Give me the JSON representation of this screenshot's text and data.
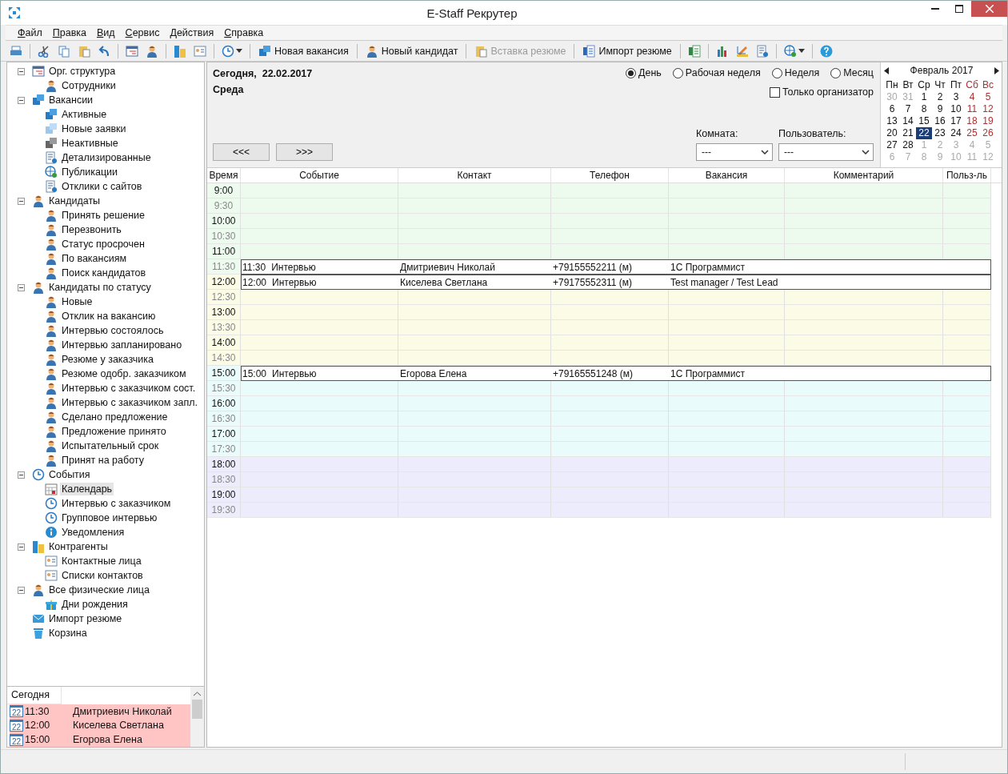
{
  "window": {
    "title": "E-Staff Рекрутер"
  },
  "menu": [
    "Файл",
    "Правка",
    "Вид",
    "Сервис",
    "Действия",
    "Справка"
  ],
  "toolbar": [
    {
      "kind": "icon"
    },
    {
      "kind": "sep"
    },
    {
      "kind": "icon"
    },
    {
      "kind": "icon"
    },
    {
      "kind": "icon"
    },
    {
      "kind": "icon"
    },
    {
      "kind": "sep"
    },
    {
      "kind": "icon"
    },
    {
      "kind": "icon"
    },
    {
      "kind": "sep"
    },
    {
      "kind": "icon"
    },
    {
      "kind": "icon"
    },
    {
      "kind": "sep"
    },
    {
      "kind": "dropdown"
    },
    {
      "kind": "sep"
    },
    {
      "kind": "button",
      "label": "Новая вакансия",
      "disabled": false
    },
    {
      "kind": "sep"
    },
    {
      "kind": "button",
      "label": "Новый кандидат",
      "disabled": false
    },
    {
      "kind": "sep"
    },
    {
      "kind": "button",
      "label": "Вставка резюме",
      "disabled": true
    },
    {
      "kind": "sep"
    },
    {
      "kind": "button",
      "label": "Импорт резюме",
      "disabled": false
    },
    {
      "kind": "sep"
    },
    {
      "kind": "icon"
    },
    {
      "kind": "sep"
    },
    {
      "kind": "icon"
    },
    {
      "kind": "icon"
    },
    {
      "kind": "icon"
    },
    {
      "kind": "sep"
    },
    {
      "kind": "dropdown"
    },
    {
      "kind": "sep"
    },
    {
      "kind": "icon"
    }
  ],
  "tree": [
    {
      "label": "Орг. структура",
      "kind": "card",
      "expanded": true,
      "selected": false,
      "children": [
        {
          "label": "Сотрудники",
          "kind": "person",
          "selected": false
        }
      ]
    },
    {
      "label": "Вакансии",
      "kind": "vacancy",
      "expanded": true,
      "selected": false,
      "children": [
        {
          "label": "Активные",
          "kind": "vacancy",
          "selected": false
        },
        {
          "label": "Новые заявки",
          "kind": "request",
          "selected": false
        },
        {
          "label": "Неактивные",
          "kind": "inactive",
          "selected": false
        },
        {
          "label": "Детализированные",
          "kind": "doc",
          "selected": false
        },
        {
          "label": "Публикации",
          "kind": "globe",
          "selected": false
        },
        {
          "label": "Отклики с сайтов",
          "kind": "doc",
          "selected": false
        }
      ]
    },
    {
      "label": "Кандидаты",
      "kind": "person",
      "expanded": true,
      "selected": false,
      "children": [
        {
          "label": "Принять решение",
          "kind": "person",
          "selected": false
        },
        {
          "label": "Перезвонить",
          "kind": "person",
          "selected": false
        },
        {
          "label": "Статус просрочен",
          "kind": "person",
          "selected": false
        },
        {
          "label": "По вакансиям",
          "kind": "person",
          "selected": false
        },
        {
          "label": "Поиск кандидатов",
          "kind": "person",
          "selected": false
        }
      ]
    },
    {
      "label": "Кандидаты по статусу",
      "kind": "person",
      "expanded": true,
      "selected": false,
      "children": [
        {
          "label": "Новые",
          "kind": "person",
          "selected": false
        },
        {
          "label": "Отклик на вакансию",
          "kind": "person",
          "selected": false
        },
        {
          "label": "Интервью состоялось",
          "kind": "person",
          "selected": false
        },
        {
          "label": "Интервью запланировано",
          "kind": "person",
          "selected": false
        },
        {
          "label": "Резюме у заказчика",
          "kind": "person",
          "selected": false
        },
        {
          "label": "Резюме одобр. заказчиком",
          "kind": "person",
          "selected": false
        },
        {
          "label": "Интервью с заказчиком сост.",
          "kind": "person",
          "selected": false
        },
        {
          "label": "Интервью с заказчиком запл.",
          "kind": "person",
          "selected": false
        },
        {
          "label": "Сделано предложение",
          "kind": "person",
          "selected": false
        },
        {
          "label": "Предложение принято",
          "kind": "person",
          "selected": false
        },
        {
          "label": "Испытательный срок",
          "kind": "person",
          "selected": false
        },
        {
          "label": "Принят на работу",
          "kind": "person",
          "selected": false
        }
      ]
    },
    {
      "label": "События",
      "kind": "clock",
      "expanded": true,
      "selected": false,
      "children": [
        {
          "label": "Календарь",
          "kind": "calendar",
          "selected": true
        },
        {
          "label": "Интервью с заказчиком",
          "kind": "clock",
          "selected": false
        },
        {
          "label": "Групповое интервью",
          "kind": "clock",
          "selected": false
        },
        {
          "label": "Уведомления",
          "kind": "info",
          "selected": false
        }
      ]
    },
    {
      "label": "Контрагенты",
      "kind": "buildings",
      "expanded": true,
      "selected": false,
      "children": [
        {
          "label": "Контактные лица",
          "kind": "contact",
          "selected": false
        },
        {
          "label": "Списки контактов",
          "kind": "contact",
          "selected": false
        }
      ]
    },
    {
      "label": "Все физические лица",
      "kind": "person",
      "expanded": true,
      "selected": false,
      "children": [
        {
          "label": "Дни рождения",
          "kind": "gift",
          "selected": false
        }
      ]
    },
    {
      "label": "Импорт резюме",
      "kind": "mail",
      "selected": false
    },
    {
      "label": "Корзина",
      "kind": "bin",
      "selected": false
    }
  ],
  "today_panel": {
    "header": "Сегодня",
    "rows": [
      {
        "icon_text": "22",
        "time": "11:30",
        "name": "Дмитриевич Николай"
      },
      {
        "icon_text": "22",
        "time": "12:00",
        "name": "Киселева Светлана"
      },
      {
        "icon_text": "22",
        "time": "15:00",
        "name": "Егорова Елена"
      }
    ]
  },
  "header": {
    "date_label": "Сегодня,  22.02.2017",
    "weekday": "Среда",
    "views": [
      {
        "label": "День",
        "selected": true
      },
      {
        "label": "Рабочая неделя",
        "selected": false
      },
      {
        "label": "Неделя",
        "selected": false
      },
      {
        "label": "Месяц",
        "selected": false
      }
    ],
    "organizer_only": {
      "label": "Только организатор",
      "checked": false
    },
    "prev_button": "<<<",
    "next_button": ">>>",
    "room": {
      "label": "Комната:",
      "value": "---"
    },
    "user": {
      "label": "Пользователь:",
      "value": "---"
    }
  },
  "mini_calendar": {
    "month": "Февраль 2017",
    "weekdays": [
      "Пн",
      "Вт",
      "Ср",
      "Чт",
      "Пт",
      "Сб",
      "Вс"
    ],
    "weeks": [
      [
        {
          "day": "30",
          "other": true,
          "selected": false
        },
        {
          "day": "31",
          "other": true,
          "selected": false
        },
        {
          "day": "1",
          "other": false,
          "selected": false
        },
        {
          "day": "2",
          "other": false,
          "selected": false
        },
        {
          "day": "3",
          "other": false,
          "selected": false
        },
        {
          "day": "4",
          "other": false,
          "selected": false
        },
        {
          "day": "5",
          "other": false,
          "selected": false
        }
      ],
      [
        {
          "day": "6",
          "other": false,
          "selected": false
        },
        {
          "day": "7",
          "other": false,
          "selected": false
        },
        {
          "day": "8",
          "other": false,
          "selected": false
        },
        {
          "day": "9",
          "other": false,
          "selected": false
        },
        {
          "day": "10",
          "other": false,
          "selected": false
        },
        {
          "day": "11",
          "other": false,
          "selected": false
        },
        {
          "day": "12",
          "other": false,
          "selected": false
        }
      ],
      [
        {
          "day": "13",
          "other": false,
          "selected": false
        },
        {
          "day": "14",
          "other": false,
          "selected": false
        },
        {
          "day": "15",
          "other": false,
          "selected": false
        },
        {
          "day": "16",
          "other": false,
          "selected": false
        },
        {
          "day": "17",
          "other": false,
          "selected": false
        },
        {
          "day": "18",
          "other": false,
          "selected": false
        },
        {
          "day": "19",
          "other": false,
          "selected": false
        }
      ],
      [
        {
          "day": "20",
          "other": false,
          "selected": false
        },
        {
          "day": "21",
          "other": false,
          "selected": false
        },
        {
          "day": "22",
          "other": false,
          "selected": true
        },
        {
          "day": "23",
          "other": false,
          "selected": false
        },
        {
          "day": "24",
          "other": false,
          "selected": false
        },
        {
          "day": "25",
          "other": false,
          "selected": false
        },
        {
          "day": "26",
          "other": false,
          "selected": false
        }
      ],
      [
        {
          "day": "27",
          "other": false,
          "selected": false
        },
        {
          "day": "28",
          "other": false,
          "selected": false
        },
        {
          "day": "1",
          "other": true,
          "selected": false
        },
        {
          "day": "2",
          "other": true,
          "selected": false
        },
        {
          "day": "3",
          "other": true,
          "selected": false
        },
        {
          "day": "4",
          "other": true,
          "selected": false
        },
        {
          "day": "5",
          "other": true,
          "selected": false
        }
      ],
      [
        {
          "day": "6",
          "other": true,
          "selected": false
        },
        {
          "day": "7",
          "other": true,
          "selected": false
        },
        {
          "day": "8",
          "other": true,
          "selected": false
        },
        {
          "day": "9",
          "other": true,
          "selected": false
        },
        {
          "day": "10",
          "other": true,
          "selected": false
        },
        {
          "day": "11",
          "other": true,
          "selected": false
        },
        {
          "day": "12",
          "other": true,
          "selected": false
        }
      ]
    ]
  },
  "schedule": {
    "columns": [
      "Время",
      "Событие",
      "Контакт",
      "Телефон",
      "Вакансия",
      "Комментарий",
      "Польз-ль"
    ],
    "slots": [
      {
        "time": "9:00",
        "kind": "hour",
        "color": "#edfbee"
      },
      {
        "time": "9:30",
        "kind": "half",
        "color": "#edfbee"
      },
      {
        "time": "10:00",
        "kind": "hour",
        "color": "#edfbee"
      },
      {
        "time": "10:30",
        "kind": "half",
        "color": "#edfbee"
      },
      {
        "time": "11:00",
        "kind": "hour",
        "color": "#edfbee"
      },
      {
        "time": "11:30",
        "kind": "half",
        "color": "#edfbee",
        "event": {
          "time": "11:30",
          "type": "Интервью",
          "contact": "Дмитриевич Николай",
          "phone": "+79155552211 (м)",
          "vacancy": "1С Программист"
        }
      },
      {
        "time": "12:00",
        "kind": "hour",
        "color": "#fcfce6",
        "event": {
          "time": "12:00",
          "type": "Интервью",
          "contact": "Киселева Светлана",
          "phone": "+79175552311 (м)",
          "vacancy": "Test manager / Test Lead"
        }
      },
      {
        "time": "12:30",
        "kind": "half",
        "color": "#fcfce6"
      },
      {
        "time": "13:00",
        "kind": "hour",
        "color": "#fcfce6"
      },
      {
        "time": "13:30",
        "kind": "half",
        "color": "#fcfce6"
      },
      {
        "time": "14:00",
        "kind": "hour",
        "color": "#fcfce6"
      },
      {
        "time": "14:30",
        "kind": "half",
        "color": "#fcfce6"
      },
      {
        "time": "15:00",
        "kind": "hour",
        "color": "#eafbfb",
        "event": {
          "time": "15:00",
          "type": "Интервью",
          "contact": "Егорова Елена",
          "phone": "+79165551248 (м)",
          "vacancy": "1С Программист"
        }
      },
      {
        "time": "15:30",
        "kind": "half",
        "color": "#eafbfb"
      },
      {
        "time": "16:00",
        "kind": "hour",
        "color": "#eafbfb"
      },
      {
        "time": "16:30",
        "kind": "half",
        "color": "#eafbfb"
      },
      {
        "time": "17:00",
        "kind": "hour",
        "color": "#eafbfb"
      },
      {
        "time": "17:30",
        "kind": "half",
        "color": "#eafbfb"
      },
      {
        "time": "18:00",
        "kind": "hour",
        "color": "#ececfc"
      },
      {
        "time": "18:30",
        "kind": "half",
        "color": "#ececfc"
      },
      {
        "time": "19:00",
        "kind": "hour",
        "color": "#ececfc"
      },
      {
        "time": "19:30",
        "kind": "half",
        "color": "#ececfc"
      }
    ]
  }
}
